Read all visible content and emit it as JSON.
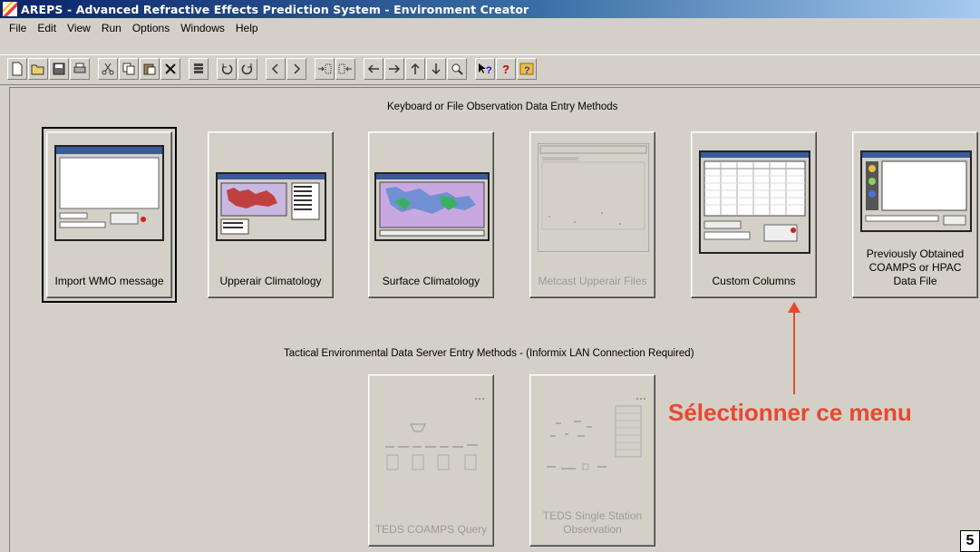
{
  "window": {
    "title": "AREPS - Advanced Refractive Effects Prediction System - Environment Creator"
  },
  "menu": [
    "File",
    "Edit",
    "View",
    "Run",
    "Options",
    "Windows",
    "Help"
  ],
  "sections": {
    "keyboard": "Keyboard or File Observation Data Entry Methods",
    "teds": "Tactical Environmental Data Server Entry Methods - (Informix LAN Connection Required)"
  },
  "tiles": {
    "import_wmo": {
      "label": "Import WMO message",
      "enabled": true,
      "selected": true
    },
    "upperair_climatology": {
      "label": "Upperair Climatology",
      "enabled": true
    },
    "surface_climatology": {
      "label": "Surface Climatology",
      "enabled": true
    },
    "metcast_upperair": {
      "label": "Metcast Upperair Files",
      "enabled": false
    },
    "custom_columns": {
      "label": "Custom Columns",
      "enabled": true
    },
    "previously_obtained": {
      "label": "Previously Obtained COAMPS or HPAC Data File",
      "enabled": true
    },
    "teds_coamps": {
      "label": "TEDS COAMPS Query",
      "enabled": false
    },
    "teds_single_station": {
      "label": "TEDS Single Station Observation",
      "enabled": false
    }
  },
  "annotation": {
    "text": "Sélectionner ce menu",
    "color": "#e8482d"
  },
  "page_number": "5",
  "icons": [
    "new-icon",
    "open-icon",
    "save-icon",
    "print-icon",
    "cut-icon",
    "copy-icon",
    "paste-icon",
    "delete-icon",
    "stack-icon",
    "rotate-left-icon",
    "rotate-right-icon",
    "prev-icon",
    "next-icon",
    "expand-icon",
    "collapse-icon",
    "arrow-left-icon",
    "arrow-right-icon",
    "arrow-up-icon",
    "arrow-down-icon",
    "zoom-icon",
    "context-help-icon",
    "help-icon",
    "about-icon"
  ]
}
